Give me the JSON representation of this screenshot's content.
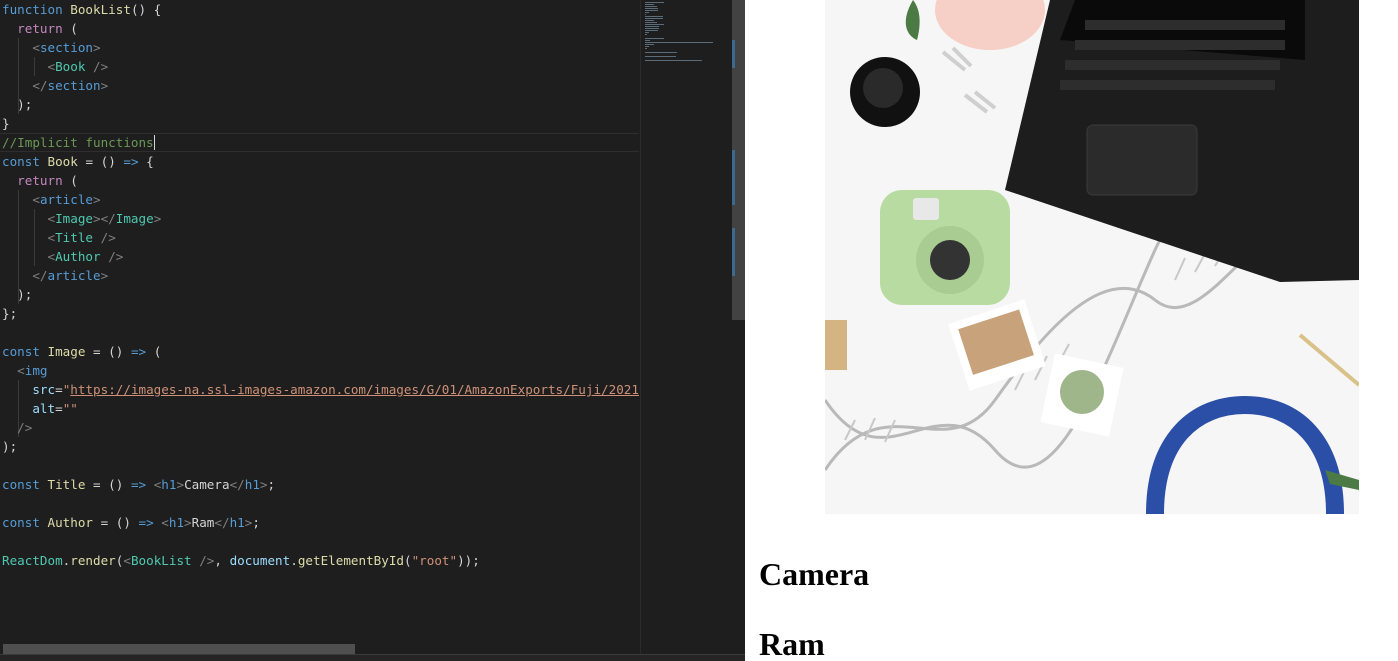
{
  "editor": {
    "code_lines": [
      [
        [
          "kw",
          "function"
        ],
        [
          "punc",
          " "
        ],
        [
          "fn",
          "BookList"
        ],
        [
          "punc",
          "() {"
        ]
      ],
      [
        [
          "punc",
          "  "
        ],
        [
          "kw2",
          "return"
        ],
        [
          "punc",
          " ("
        ]
      ],
      [
        [
          "punc",
          "    "
        ],
        [
          "brk",
          "<"
        ],
        [
          "tag",
          "section"
        ],
        [
          "brk",
          ">"
        ]
      ],
      [
        [
          "punc",
          "      "
        ],
        [
          "brk",
          "<"
        ],
        [
          "comp",
          "Book"
        ],
        [
          "punc",
          " "
        ],
        [
          "brk",
          "/>"
        ]
      ],
      [
        [
          "punc",
          "    "
        ],
        [
          "brk",
          "</"
        ],
        [
          "tag",
          "section"
        ],
        [
          "brk",
          ">"
        ]
      ],
      [
        [
          "punc",
          "  );"
        ]
      ],
      [
        [
          "punc",
          "}"
        ]
      ],
      [
        [
          "com",
          "//Implicit functions"
        ]
      ],
      [
        [
          "kw",
          "const"
        ],
        [
          "punc",
          " "
        ],
        [
          "fn",
          "Book"
        ],
        [
          "punc",
          " = () "
        ],
        [
          "kw",
          "=>"
        ],
        [
          "punc",
          " {"
        ]
      ],
      [
        [
          "punc",
          "  "
        ],
        [
          "kw2",
          "return"
        ],
        [
          "punc",
          " ("
        ]
      ],
      [
        [
          "punc",
          "    "
        ],
        [
          "brk",
          "<"
        ],
        [
          "tag",
          "article"
        ],
        [
          "brk",
          ">"
        ]
      ],
      [
        [
          "punc",
          "      "
        ],
        [
          "brk",
          "<"
        ],
        [
          "comp",
          "Image"
        ],
        [
          "brk",
          "></"
        ],
        [
          "comp",
          "Image"
        ],
        [
          "brk",
          ">"
        ]
      ],
      [
        [
          "punc",
          "      "
        ],
        [
          "brk",
          "<"
        ],
        [
          "comp",
          "Title"
        ],
        [
          "punc",
          " "
        ],
        [
          "brk",
          "/>"
        ]
      ],
      [
        [
          "punc",
          "      "
        ],
        [
          "brk",
          "<"
        ],
        [
          "comp",
          "Author"
        ],
        [
          "punc",
          " "
        ],
        [
          "brk",
          "/>"
        ]
      ],
      [
        [
          "punc",
          "    "
        ],
        [
          "brk",
          "</"
        ],
        [
          "tag",
          "article"
        ],
        [
          "brk",
          ">"
        ]
      ],
      [
        [
          "punc",
          "  );"
        ]
      ],
      [
        [
          "punc",
          "};"
        ]
      ],
      [
        [
          "punc",
          ""
        ]
      ],
      [
        [
          "kw",
          "const"
        ],
        [
          "punc",
          " "
        ],
        [
          "fn",
          "Image"
        ],
        [
          "punc",
          " = () "
        ],
        [
          "kw",
          "=>"
        ],
        [
          "punc",
          " ("
        ]
      ],
      [
        [
          "punc",
          "  "
        ],
        [
          "brk",
          "<"
        ],
        [
          "tag",
          "img"
        ]
      ],
      [
        [
          "punc",
          "    "
        ],
        [
          "var",
          "src"
        ],
        [
          "punc",
          "="
        ],
        [
          "str",
          "\""
        ],
        [
          "link",
          "https://images-na.ssl-images-amazon.com/images/G/01/AmazonExports/Fuji/2021/May/Dashboard/Fuji_Dash_Electronics_1x._SY304_CB432774322_.jpg"
        ],
        [
          "str",
          "\""
        ]
      ],
      [
        [
          "punc",
          "    "
        ],
        [
          "var",
          "alt"
        ],
        [
          "punc",
          "="
        ],
        [
          "str",
          "\"\""
        ]
      ],
      [
        [
          "punc",
          "  "
        ],
        [
          "brk",
          "/>"
        ]
      ],
      [
        [
          "punc",
          ");"
        ]
      ],
      [
        [
          "punc",
          ""
        ]
      ],
      [
        [
          "kw",
          "const"
        ],
        [
          "punc",
          " "
        ],
        [
          "fn",
          "Title"
        ],
        [
          "punc",
          " = () "
        ],
        [
          "kw",
          "=>"
        ],
        [
          "punc",
          " "
        ],
        [
          "brk",
          "<"
        ],
        [
          "tag",
          "h1"
        ],
        [
          "brk",
          ">"
        ],
        [
          "punc",
          "Camera"
        ],
        [
          "brk",
          "</"
        ],
        [
          "tag",
          "h1"
        ],
        [
          "brk",
          ">"
        ],
        [
          "punc",
          ";"
        ]
      ],
      [
        [
          "punc",
          ""
        ]
      ],
      [
        [
          "kw",
          "const"
        ],
        [
          "punc",
          " "
        ],
        [
          "fn",
          "Author"
        ],
        [
          "punc",
          " = () "
        ],
        [
          "kw",
          "=>"
        ],
        [
          "punc",
          " "
        ],
        [
          "brk",
          "<"
        ],
        [
          "tag",
          "h1"
        ],
        [
          "brk",
          ">"
        ],
        [
          "punc",
          "Ram"
        ],
        [
          "brk",
          "</"
        ],
        [
          "tag",
          "h1"
        ],
        [
          "brk",
          ">"
        ],
        [
          "punc",
          ";"
        ]
      ],
      [
        [
          "punc",
          ""
        ]
      ],
      [
        [
          "comp",
          "ReactDom"
        ],
        [
          "punc",
          "."
        ],
        [
          "fn",
          "render"
        ],
        [
          "punc",
          "("
        ],
        [
          "brk",
          "<"
        ],
        [
          "comp",
          "BookList"
        ],
        [
          "punc",
          " "
        ],
        [
          "brk",
          "/>"
        ],
        [
          "punc",
          ", "
        ],
        [
          "var",
          "document"
        ],
        [
          "punc",
          "."
        ],
        [
          "fn",
          "getElementById"
        ],
        [
          "punc",
          "("
        ],
        [
          "str",
          "\"root\""
        ],
        [
          "punc",
          "));"
        ]
      ]
    ],
    "cursor_line": 7,
    "colors": {
      "background": "#1e1e1e",
      "keyword": "#569cd6",
      "control_keyword": "#c586c0",
      "function": "#dcdcaa",
      "component": "#4ec9b0",
      "string": "#ce9178",
      "comment": "#6a9955"
    }
  },
  "preview": {
    "image_alt": "",
    "title": "Camera",
    "author": "Ram"
  }
}
